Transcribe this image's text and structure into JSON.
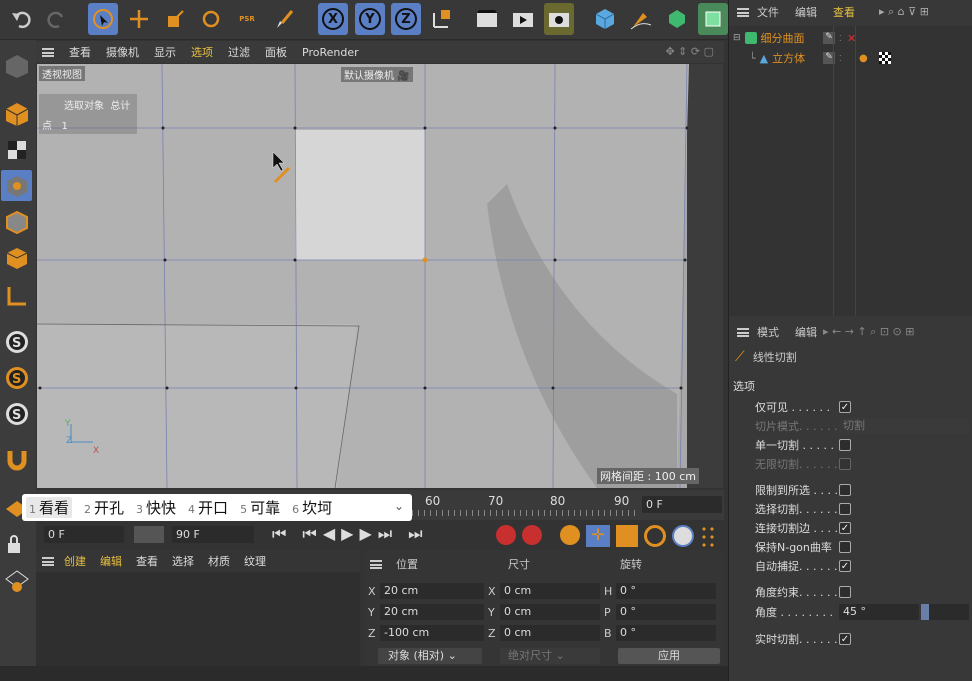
{
  "viewport": {
    "menu": [
      "查看",
      "摄像机",
      "显示",
      "选项",
      "过滤",
      "面板",
      "ProRender"
    ],
    "name": "透视视图",
    "camera": "默认摄像机",
    "info_header": [
      "选取对象",
      "总计"
    ],
    "info_row": [
      "点",
      "1"
    ],
    "grid_spacing": "网格间距 : 100 cm"
  },
  "toolbar": {
    "axes": [
      "X",
      "Y",
      "Z"
    ],
    "psr": "PSR"
  },
  "timeline": {
    "ticks": [
      "60",
      "70",
      "80",
      "90"
    ],
    "frame": "0 F",
    "start": "0 F",
    "end": "90 F"
  },
  "tabs": [
    {
      "num": "1",
      "label": "看看"
    },
    {
      "num": "2",
      "label": "开孔"
    },
    {
      "num": "3",
      "label": "快快"
    },
    {
      "num": "4",
      "label": "开口"
    },
    {
      "num": "5",
      "label": "可靠"
    },
    {
      "num": "6",
      "label": "坎坷"
    }
  ],
  "object_manager": {
    "menu": [
      "文件",
      "编辑",
      "查看"
    ],
    "items": [
      {
        "name": "细分曲面"
      },
      {
        "name": "立方体"
      }
    ]
  },
  "bottom_objects": {
    "menu": [
      "创建",
      "编辑",
      "查看",
      "选择",
      "材质",
      "纹理"
    ]
  },
  "coords": {
    "headers": [
      "位置",
      "尺寸",
      "旋转"
    ],
    "rows": [
      {
        "a": "X",
        "pos": "20 cm",
        "b": "X",
        "size": "0 cm",
        "c": "H",
        "rot": "0 °"
      },
      {
        "a": "Y",
        "pos": "20 cm",
        "b": "Y",
        "size": "0 cm",
        "c": "P",
        "rot": "0 °"
      },
      {
        "a": "Z",
        "pos": "-100 cm",
        "b": "Z",
        "size": "0 cm",
        "c": "B",
        "rot": "0 °"
      }
    ],
    "mode": "对象 (相对)",
    "size_mode": "绝对尺寸",
    "apply": "应用"
  },
  "attributes": {
    "menu": [
      "模式",
      "编辑"
    ],
    "tool": "线性切割",
    "section": "选项",
    "options": [
      {
        "label": "仅可见 . . . . . .",
        "checked": true,
        "dim": false
      },
      {
        "label": "切片模式. . . . . .",
        "dropdown": "切割",
        "dim": true
      },
      {
        "label": "单一切割 . . . . .",
        "checked": false,
        "dim": false
      },
      {
        "label": "无限切割. . . . . .",
        "checked": false,
        "dim": true
      },
      {
        "label": "限制到所选 . . . .",
        "checked": false,
        "dim": false
      },
      {
        "label": "选择切割. . . . . .",
        "checked": false,
        "dim": false
      },
      {
        "label": "连接切割边 . . . .",
        "checked": true,
        "dim": false
      },
      {
        "label": "保持N-gon曲率",
        "checked": false,
        "dim": false
      },
      {
        "label": "自动捕捉. . . . . .",
        "checked": true,
        "dim": false
      },
      {
        "label": "角度约束. . . . . .",
        "checked": false,
        "dim": false
      },
      {
        "label": "角度 . . . . . . . .",
        "value": "45 °",
        "dim": false
      },
      {
        "label": "实时切割. . . . . .",
        "checked": true,
        "dim": false
      }
    ]
  }
}
